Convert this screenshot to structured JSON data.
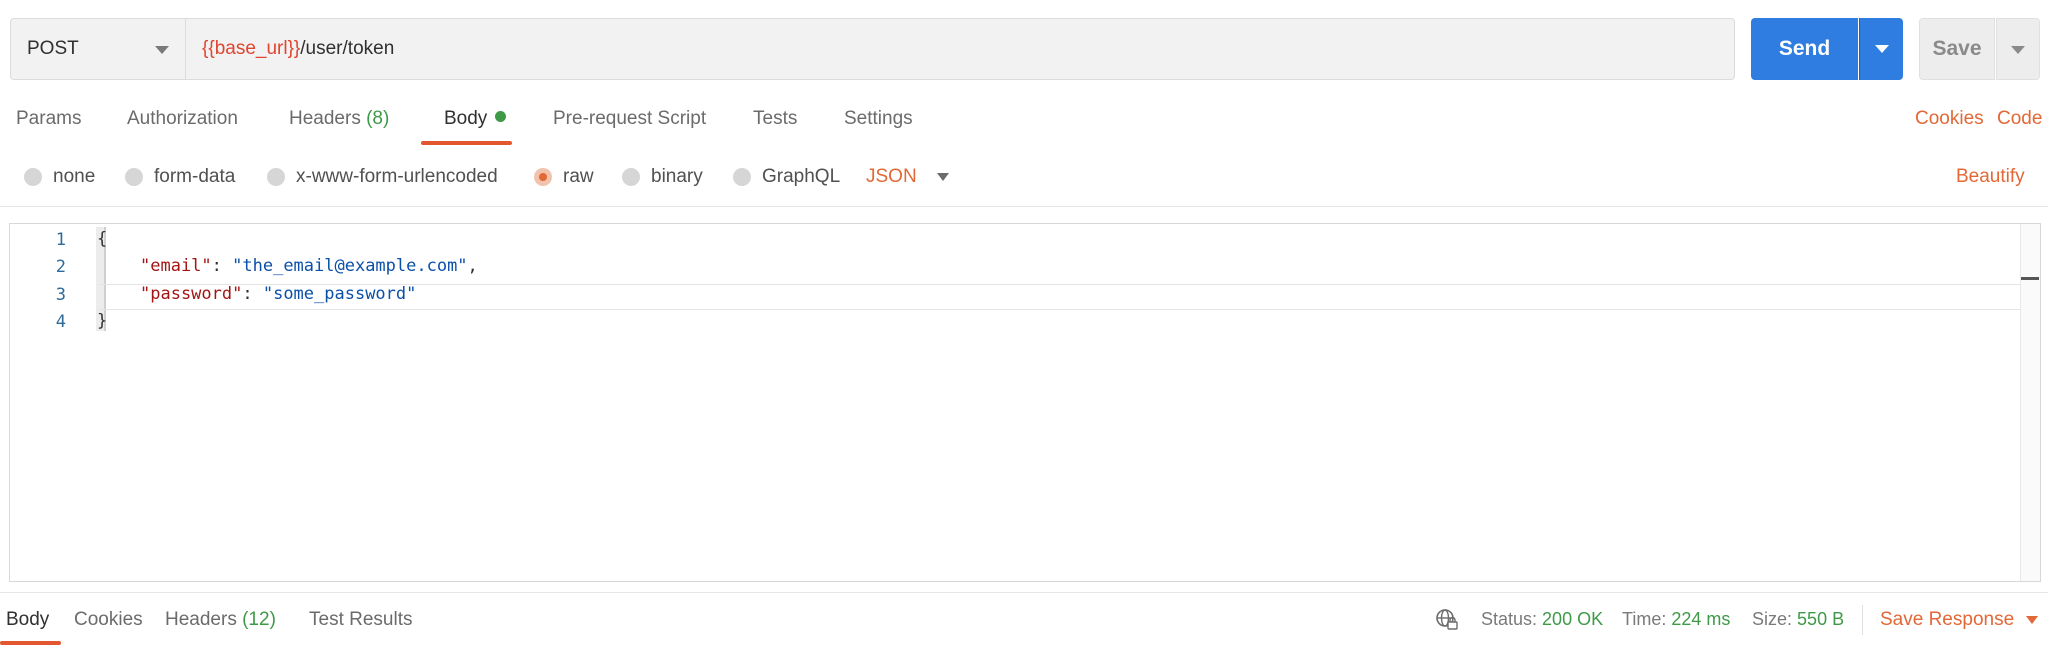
{
  "request": {
    "method": "POST",
    "url_variable": "{{base_url}}",
    "url_path": "/user/token",
    "send_label": "Send",
    "save_label": "Save"
  },
  "tabs": {
    "params": "Params",
    "authorization": "Authorization",
    "headers": "Headers",
    "headers_count": "(8)",
    "body": "Body",
    "pre_request": "Pre-request Script",
    "tests": "Tests",
    "settings": "Settings",
    "cookies": "Cookies",
    "code": "Code"
  },
  "body_modes": {
    "none": "none",
    "form_data": "form-data",
    "urlencoded": "x-www-form-urlencoded",
    "raw": "raw",
    "binary": "binary",
    "graphql": "GraphQL",
    "selected": "raw",
    "language": "JSON",
    "beautify": "Beautify"
  },
  "editor": {
    "line_numbers": [
      "1",
      "2",
      "3",
      "4"
    ],
    "open_brace": "{",
    "close_brace": "}",
    "email_key": "\"email\"",
    "email_value": "\"the_email@example.com\"",
    "password_key": "\"password\"",
    "password_value": "\"some_password\""
  },
  "response": {
    "tabs": {
      "body": "Body",
      "cookies": "Cookies",
      "headers": "Headers",
      "headers_count": "(12)",
      "test_results": "Test Results"
    },
    "status_label": "Status:",
    "status_value": "200 OK",
    "time_label": "Time:",
    "time_value": "224 ms",
    "size_label": "Size:",
    "size_value": "550 B",
    "save_response": "Save Response"
  },
  "colors": {
    "accent": "#e26836",
    "send_blue": "#2f7de1",
    "success_green": "#3f9a48"
  },
  "icons": [
    "chevron-down-icon",
    "status-dot-icon",
    "globe-lock-icon"
  ]
}
